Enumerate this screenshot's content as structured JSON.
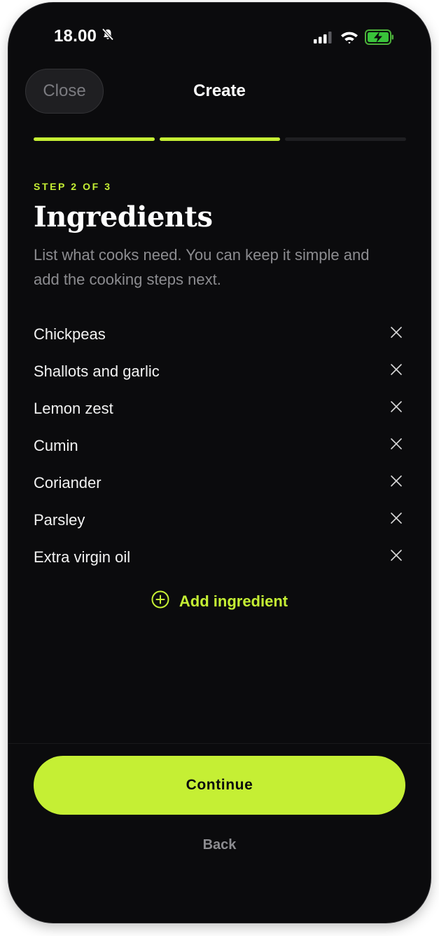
{
  "status_bar": {
    "time": "18.00",
    "icons": [
      "bell-slash-icon",
      "signal-icon",
      "wifi-icon",
      "battery-charging-icon"
    ]
  },
  "header": {
    "close_label": "Close",
    "title": "Create"
  },
  "progress": {
    "total_steps": 3,
    "completed_steps": 2
  },
  "content": {
    "step_label": "STEP 2 OF 3",
    "title": "Ingredients",
    "subtitle": "List what cooks need. You can keep it simple and add the cooking steps next.",
    "ingredients": [
      {
        "name": "Chickpeas"
      },
      {
        "name": "Shallots and garlic"
      },
      {
        "name": "Lemon zest"
      },
      {
        "name": "Cumin"
      },
      {
        "name": "Coriander"
      },
      {
        "name": "Parsley"
      },
      {
        "name": "Extra virgin oil"
      }
    ],
    "add_label": "Add ingredient"
  },
  "footer": {
    "continue_label": "Continue",
    "back_label": "Back"
  },
  "colors": {
    "accent": "#c5ef34",
    "background": "#0b0b0d",
    "muted_text": "#8c8c90"
  }
}
